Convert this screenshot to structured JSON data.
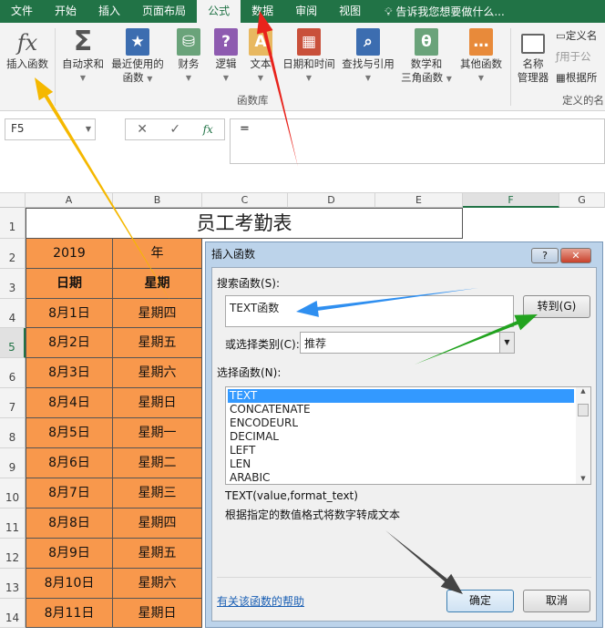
{
  "tabs": [
    "文件",
    "开始",
    "插入",
    "页面布局",
    "公式",
    "数据",
    "审阅",
    "视图"
  ],
  "active_tab": "公式",
  "tell_me": "告诉我您想要做什么...",
  "ribbon": {
    "insert_function": "插入函数",
    "buttons": [
      {
        "l1": "自动求和",
        "l2": "",
        "icon": "sigma-icon",
        "color": "#555555"
      },
      {
        "l1": "最近使用的",
        "l2": "函数",
        "icon": "star-book-icon",
        "color": "#3c6db0"
      },
      {
        "l1": "财务",
        "l2": "",
        "icon": "coins-book-icon",
        "color": "#6aa37a"
      },
      {
        "l1": "逻辑",
        "l2": "",
        "icon": "question-book-icon",
        "color": "#8e5bb0"
      },
      {
        "l1": "文本",
        "l2": "",
        "icon": "text-book-icon",
        "color": "#e8b860"
      },
      {
        "l1": "日期和时间",
        "l2": "",
        "icon": "calendar-book-icon",
        "color": "#c9503a"
      },
      {
        "l1": "查找与引用",
        "l2": "",
        "icon": "search-book-icon",
        "color": "#3c6db0"
      },
      {
        "l1": "数学和",
        "l2": "三角函数",
        "icon": "theta-book-icon",
        "color": "#6aa37a"
      },
      {
        "l1": "其他函数",
        "l2": "",
        "icon": "more-book-icon",
        "color": "#e88a3a"
      }
    ],
    "group_label": "函数库",
    "name_manager_l1": "名称",
    "name_manager_l2": "管理器",
    "define_name": "定义名",
    "use_in_formula": "用于公",
    "create_from": "根据所",
    "defined_names_label": "定义的名"
  },
  "formula_bar": {
    "name_box": "F5",
    "value": "="
  },
  "columns": [
    "A",
    "B",
    "C",
    "D",
    "E",
    "F",
    "G"
  ],
  "selected_column": "F",
  "sheet_title": "员工考勤表",
  "rows": [
    {
      "n": "1"
    },
    {
      "n": "2",
      "a": "2019",
      "b": "年"
    },
    {
      "n": "3",
      "a": "日期",
      "b": "星期",
      "bold": true
    },
    {
      "n": "4",
      "a": "8月1日",
      "b": "星期四"
    },
    {
      "n": "5",
      "a": "8月2日",
      "b": "星期五"
    },
    {
      "n": "6",
      "a": "8月3日",
      "b": "星期六"
    },
    {
      "n": "7",
      "a": "8月4日",
      "b": "星期日"
    },
    {
      "n": "8",
      "a": "8月5日",
      "b": "星期一"
    },
    {
      "n": "9",
      "a": "8月6日",
      "b": "星期二"
    },
    {
      "n": "10",
      "a": "8月7日",
      "b": "星期三"
    },
    {
      "n": "11",
      "a": "8月8日",
      "b": "星期四"
    },
    {
      "n": "12",
      "a": "8月9日",
      "b": "星期五"
    },
    {
      "n": "13",
      "a": "8月10日",
      "b": "星期六"
    },
    {
      "n": "14",
      "a": "8月11日",
      "b": "星期日"
    }
  ],
  "selected_row": "5",
  "dialog": {
    "title": "插入函数",
    "help_btn": "?",
    "close_btn": "✕",
    "search_label": "搜索函数(S):",
    "search_value": "TEXT函数",
    "go_button": "转到(G)",
    "category_label": "或选择类别(C):",
    "category_value": "推荐",
    "select_label": "选择函数(N):",
    "functions": [
      "TEXT",
      "CONCATENATE",
      "ENCODEURL",
      "DECIMAL",
      "LEFT",
      "LEN",
      "ARABIC"
    ],
    "selected_function": "TEXT",
    "syntax": "TEXT(value,format_text)",
    "description": "根据指定的数值格式将数字转成文本",
    "help_link": "有关该函数的帮助",
    "ok": "确定",
    "cancel": "取消"
  },
  "colors": {
    "excel_green": "#217346",
    "cell_orange": "#f8984c",
    "selection_blue": "#3399ff",
    "arrow_yellow": "#f5b800",
    "arrow_red": "#e8231c",
    "arrow_blue": "#2f8ff0",
    "arrow_green": "#22a31f",
    "arrow_dark": "#444444"
  }
}
